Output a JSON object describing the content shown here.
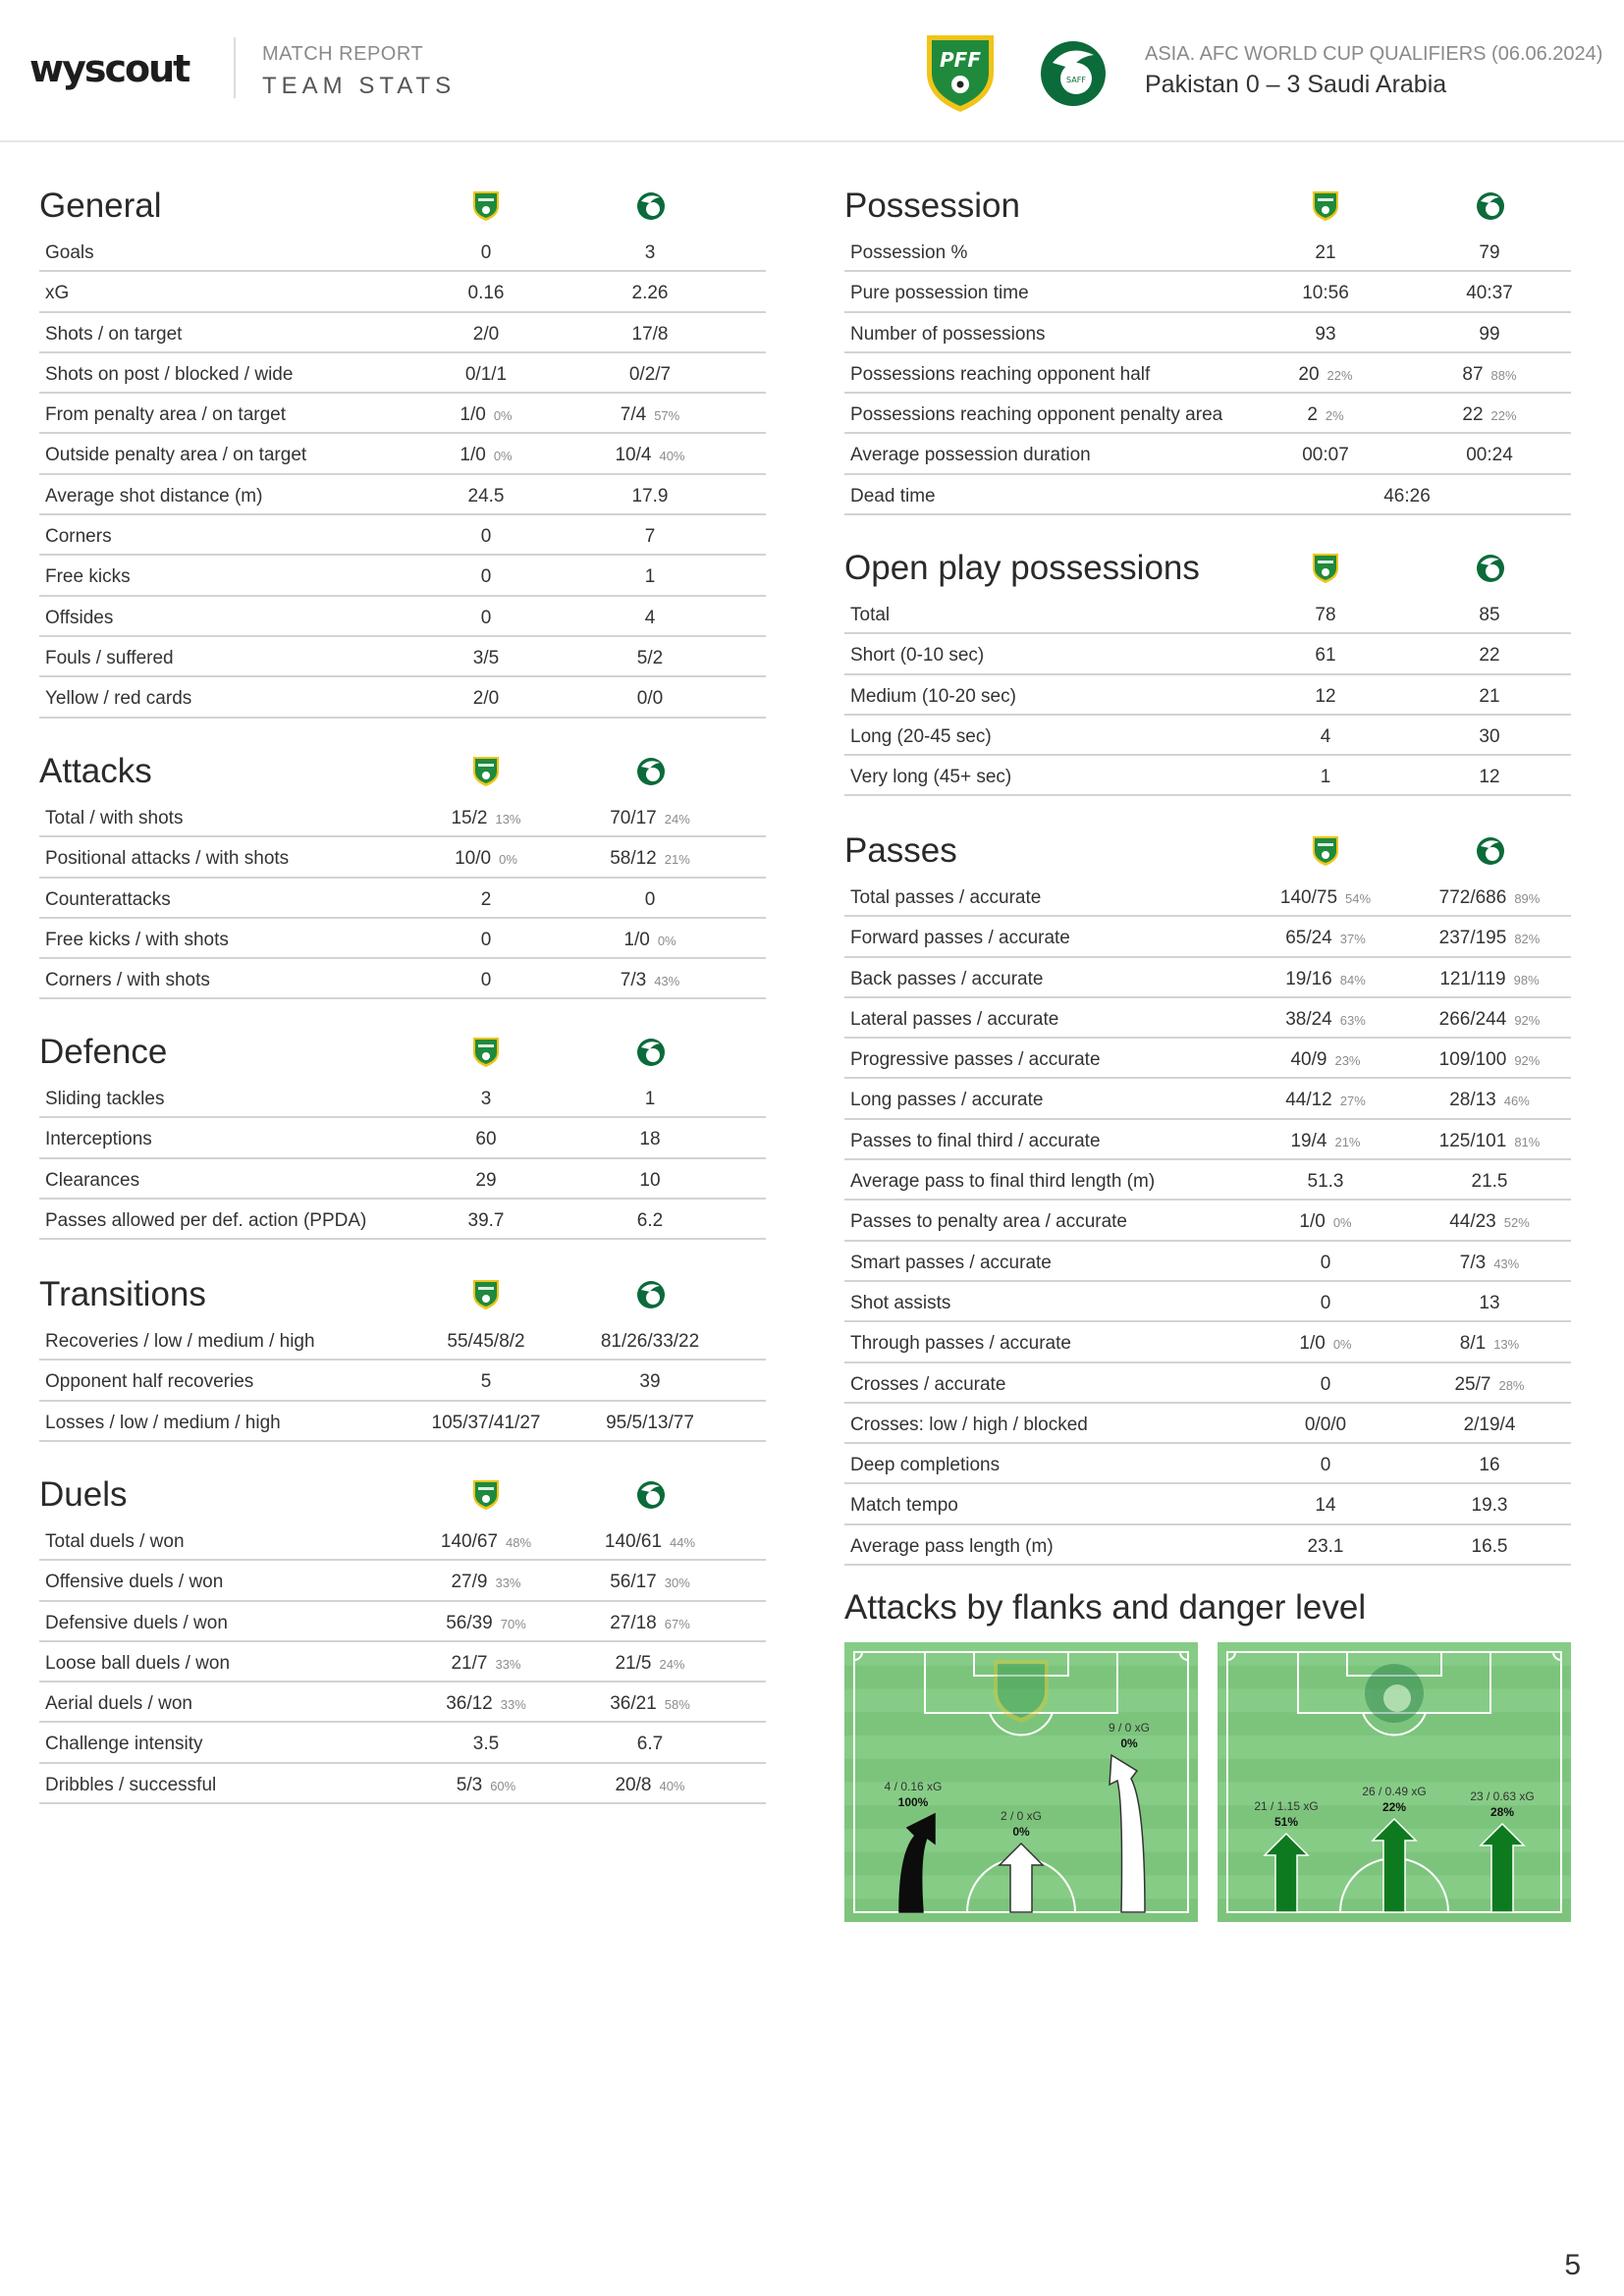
{
  "header": {
    "brand": "wyscout",
    "report_kicker": "MATCH REPORT",
    "report_title": "TEAM STATS",
    "competition": "ASIA. AFC WORLD CUP QUALIFIERS (06.06.2024)",
    "match": "Pakistan 0 – 3 Saudi Arabia",
    "home_logo_text": "PFF",
    "away_logo_text": "SAFF"
  },
  "colors": {
    "pitch": "#7cc47c",
    "pitch_stripe": "#86cc86",
    "pff_green": "#1f8a3c",
    "saff_green": "#0b6b3a",
    "rule": "#d3d3d3"
  },
  "general": {
    "title": "General",
    "rows": [
      {
        "label": "Goals",
        "home": "0",
        "away": "3"
      },
      {
        "label": "xG",
        "home": "0.16",
        "away": "2.26"
      },
      {
        "label": "Shots / on target",
        "home": "2/0",
        "away": "17/8"
      },
      {
        "label": "Shots on post / blocked / wide",
        "home": "0/1/1",
        "away": "0/2/7"
      },
      {
        "label": "From penalty area / on target",
        "home": "1/0",
        "home_pct": "0%",
        "away": "7/4",
        "away_pct": "57%"
      },
      {
        "label": "Outside penalty area / on target",
        "home": "1/0",
        "home_pct": "0%",
        "away": "10/4",
        "away_pct": "40%"
      },
      {
        "label": "Average shot distance (m)",
        "home": "24.5",
        "away": "17.9"
      },
      {
        "label": "Corners",
        "home": "0",
        "away": "7"
      },
      {
        "label": "Free kicks",
        "home": "0",
        "away": "1"
      },
      {
        "label": "Offsides",
        "home": "0",
        "away": "4"
      },
      {
        "label": "Fouls / suffered",
        "home": "3/5",
        "away": "5/2"
      },
      {
        "label": "Yellow / red cards",
        "home": "2/0",
        "away": "0/0"
      }
    ]
  },
  "attacks": {
    "title": "Attacks",
    "rows": [
      {
        "label": "Total / with shots",
        "home": "15/2",
        "home_pct": "13%",
        "away": "70/17",
        "away_pct": "24%"
      },
      {
        "label": "Positional attacks / with shots",
        "home": "10/0",
        "home_pct": "0%",
        "away": "58/12",
        "away_pct": "21%"
      },
      {
        "label": "Counterattacks",
        "home": "2",
        "away": "0"
      },
      {
        "label": "Free kicks / with shots",
        "home": "0",
        "away": "1/0",
        "away_pct": "0%"
      },
      {
        "label": "Corners / with shots",
        "home": "0",
        "away": "7/3",
        "away_pct": "43%"
      }
    ]
  },
  "defence": {
    "title": "Defence",
    "rows": [
      {
        "label": "Sliding tackles",
        "home": "3",
        "away": "1"
      },
      {
        "label": "Interceptions",
        "home": "60",
        "away": "18"
      },
      {
        "label": "Clearances",
        "home": "29",
        "away": "10"
      },
      {
        "label": "Passes allowed per def. action (PPDA)",
        "home": "39.7",
        "away": "6.2"
      }
    ]
  },
  "transitions": {
    "title": "Transitions",
    "rows": [
      {
        "label": "Recoveries / low / medium / high",
        "home": "55/45/8/2",
        "away": "81/26/33/22"
      },
      {
        "label": "Opponent half recoveries",
        "home": "5",
        "away": "39"
      },
      {
        "label": "Losses / low / medium / high",
        "home": "105/37/41/27",
        "away": "95/5/13/77"
      }
    ]
  },
  "duels": {
    "title": "Duels",
    "rows": [
      {
        "label": "Total duels / won",
        "home": "140/67",
        "home_pct": "48%",
        "away": "140/61",
        "away_pct": "44%"
      },
      {
        "label": "Offensive duels / won",
        "home": "27/9",
        "home_pct": "33%",
        "away": "56/17",
        "away_pct": "30%"
      },
      {
        "label": "Defensive duels / won",
        "home": "56/39",
        "home_pct": "70%",
        "away": "27/18",
        "away_pct": "67%"
      },
      {
        "label": "Loose ball duels / won",
        "home": "21/7",
        "home_pct": "33%",
        "away": "21/5",
        "away_pct": "24%"
      },
      {
        "label": "Aerial duels / won",
        "home": "36/12",
        "home_pct": "33%",
        "away": "36/21",
        "away_pct": "58%"
      },
      {
        "label": "Challenge intensity",
        "home": "3.5",
        "away": "6.7"
      },
      {
        "label": "Dribbles / successful",
        "home": "5/3",
        "home_pct": "60%",
        "away": "20/8",
        "away_pct": "40%"
      }
    ]
  },
  "possession": {
    "title": "Possession",
    "rows": [
      {
        "label": "Possession %",
        "home": "21",
        "away": "79"
      },
      {
        "label": "Pure possession time",
        "home": "10:56",
        "away": "40:37"
      },
      {
        "label": "Number of possessions",
        "home": "93",
        "away": "99"
      },
      {
        "label": "Possessions reaching opponent half",
        "home": "20",
        "home_pct": "22%",
        "away": "87",
        "away_pct": "88%"
      },
      {
        "label": "Possessions reaching opponent penalty area",
        "home": "2",
        "home_pct": "2%",
        "away": "22",
        "away_pct": "22%"
      },
      {
        "label": "Average possession duration",
        "home": "00:07",
        "away": "00:24"
      },
      {
        "label": "Dead time",
        "combined": "46:26"
      }
    ]
  },
  "open_play": {
    "title": "Open play possessions",
    "rows": [
      {
        "label": "Total",
        "home": "78",
        "away": "85"
      },
      {
        "label": "Short (0-10 sec)",
        "home": "61",
        "away": "22"
      },
      {
        "label": "Medium (10-20 sec)",
        "home": "12",
        "away": "21"
      },
      {
        "label": "Long (20-45 sec)",
        "home": "4",
        "away": "30"
      },
      {
        "label": "Very long (45+ sec)",
        "home": "1",
        "away": "12"
      }
    ]
  },
  "passes": {
    "title": "Passes",
    "rows": [
      {
        "label": "Total passes / accurate",
        "home": "140/75",
        "home_pct": "54%",
        "away": "772/686",
        "away_pct": "89%"
      },
      {
        "label": "Forward passes / accurate",
        "home": "65/24",
        "home_pct": "37%",
        "away": "237/195",
        "away_pct": "82%"
      },
      {
        "label": "Back passes / accurate",
        "home": "19/16",
        "home_pct": "84%",
        "away": "121/119",
        "away_pct": "98%"
      },
      {
        "label": "Lateral passes / accurate",
        "home": "38/24",
        "home_pct": "63%",
        "away": "266/244",
        "away_pct": "92%"
      },
      {
        "label": "Progressive passes / accurate",
        "home": "40/9",
        "home_pct": "23%",
        "away": "109/100",
        "away_pct": "92%"
      },
      {
        "label": "Long passes / accurate",
        "home": "44/12",
        "home_pct": "27%",
        "away": "28/13",
        "away_pct": "46%"
      },
      {
        "label": "Passes to final third / accurate",
        "home": "19/4",
        "home_pct": "21%",
        "away": "125/101",
        "away_pct": "81%"
      },
      {
        "label": "Average pass to final third length (m)",
        "home": "51.3",
        "away": "21.5"
      },
      {
        "label": "Passes to penalty area / accurate",
        "home": "1/0",
        "home_pct": "0%",
        "away": "44/23",
        "away_pct": "52%"
      },
      {
        "label": "Smart passes / accurate",
        "home": "0",
        "away": "7/3",
        "away_pct": "43%"
      },
      {
        "label": "Shot assists",
        "home": "0",
        "away": "13"
      },
      {
        "label": "Through passes / accurate",
        "home": "1/0",
        "home_pct": "0%",
        "away": "8/1",
        "away_pct": "13%"
      },
      {
        "label": "Crosses / accurate",
        "home": "0",
        "away": "25/7",
        "away_pct": "28%"
      },
      {
        "label": "Crosses: low / high / blocked",
        "home": "0/0/0",
        "away": "2/19/4"
      },
      {
        "label": "Deep completions",
        "home": "0",
        "away": "16"
      },
      {
        "label": "Match tempo",
        "home": "14",
        "away": "19.3"
      },
      {
        "label": "Average pass length (m)",
        "home": "23.1",
        "away": "16.5"
      }
    ]
  },
  "flanks": {
    "title": "Attacks by flanks and danger level",
    "home": [
      {
        "flank": "left",
        "label": "4 / 0.16 xG",
        "pct": "100%",
        "share": 1.0,
        "arrow": "black"
      },
      {
        "flank": "center",
        "label": "2 / 0 xG",
        "pct": "0%",
        "share": 0.0,
        "arrow": "white"
      },
      {
        "flank": "right",
        "label": "9 / 0 xG",
        "pct": "0%",
        "share": 0.0,
        "arrow": "white"
      }
    ],
    "away": [
      {
        "flank": "left",
        "label": "21 / 1.15 xG",
        "pct": "51%",
        "share": 0.51,
        "arrow": "green"
      },
      {
        "flank": "center",
        "label": "26 / 0.49 xG",
        "pct": "22%",
        "share": 0.22,
        "arrow": "green"
      },
      {
        "flank": "right",
        "label": "23 / 0.63 xG",
        "pct": "28%",
        "share": 0.28,
        "arrow": "green"
      }
    ]
  },
  "page_number": "5"
}
